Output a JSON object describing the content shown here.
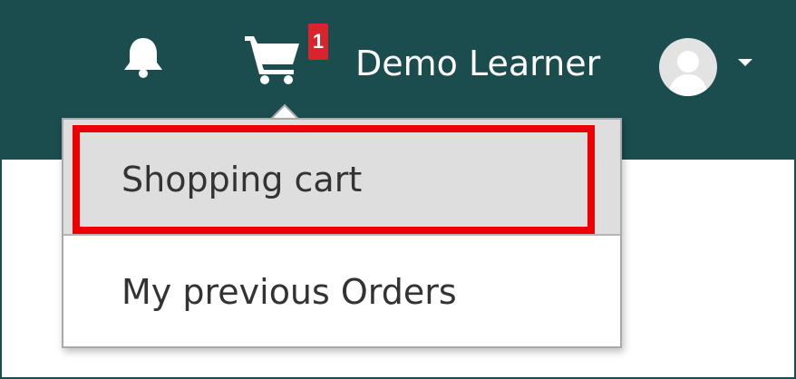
{
  "navbar": {
    "notifications_icon": "bell-icon",
    "cart_icon": "shopping-cart-icon",
    "cart_badge": "1",
    "user_name": "Demo Learner",
    "avatar_icon": "user-avatar-icon",
    "dropdown_icon": "caret-down-icon"
  },
  "cart_menu": {
    "items": [
      {
        "label": "Shopping cart",
        "highlighted": true
      },
      {
        "label": "My previous Orders",
        "highlighted": false
      }
    ]
  },
  "colors": {
    "navbar_bg": "#1b4d4f",
    "badge_bg": "#d9232d",
    "hover_bg": "#dedede",
    "highlight_border": "#ee0000"
  }
}
